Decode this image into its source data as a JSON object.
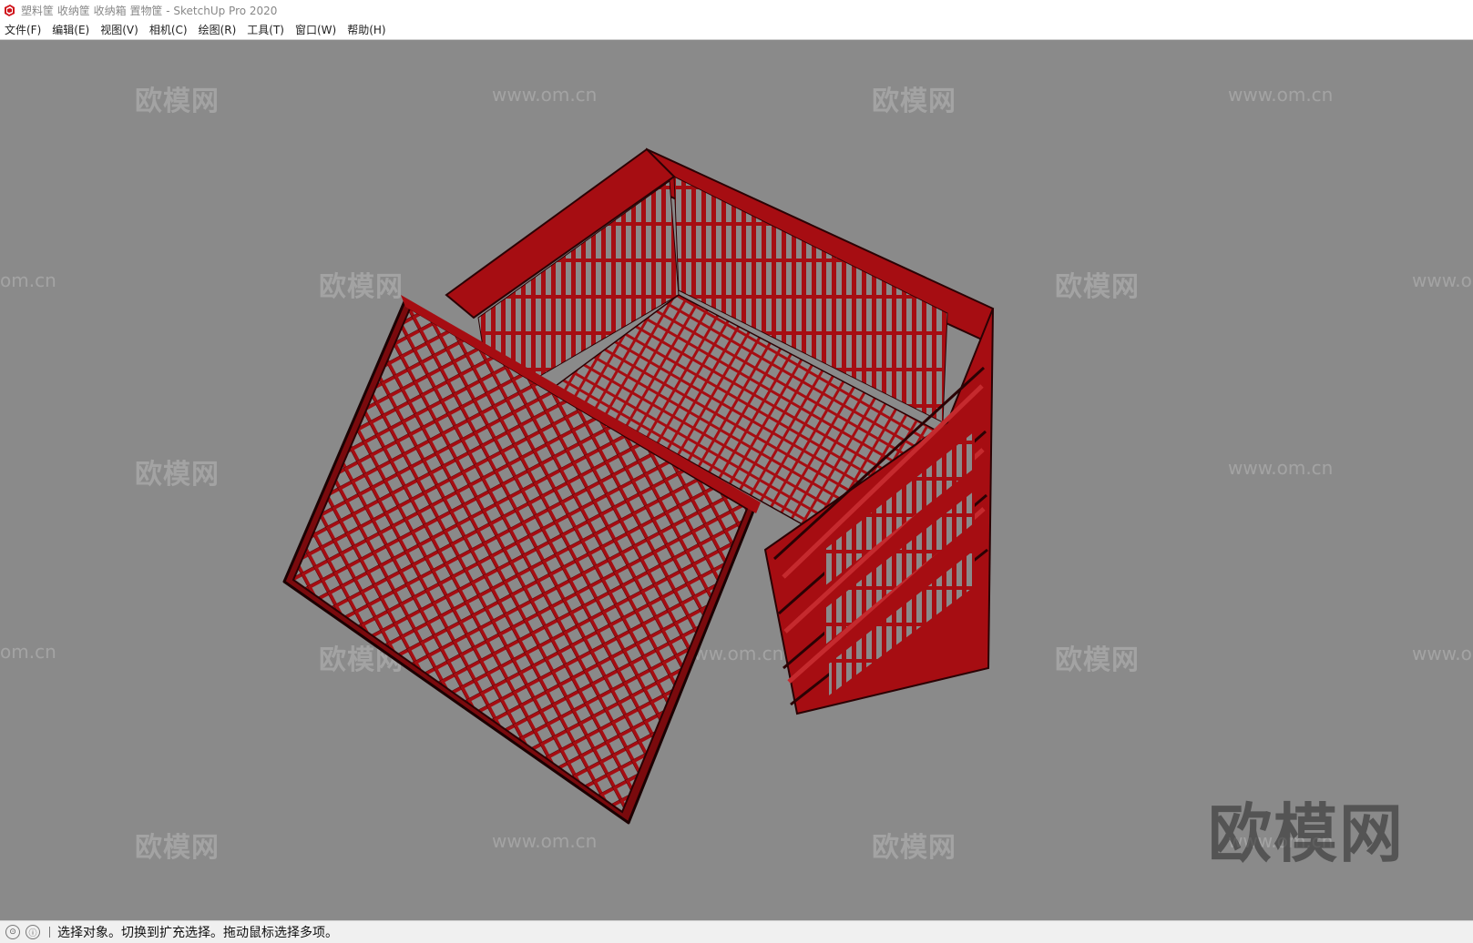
{
  "window": {
    "title": "塑料筐 收纳筐 收纳箱 置物筐 - SketchUp Pro 2020"
  },
  "menu": [
    "文件(F)",
    "编辑(E)",
    "视图(V)",
    "相机(C)",
    "绘图(R)",
    "工具(T)",
    "窗口(W)",
    "帮助(H)"
  ],
  "watermarks": {
    "brand_cn": "欧模网",
    "brand_url": "www.om.cn",
    "edge_url": "om.cn",
    "edge_url_right": "www.o"
  },
  "status": {
    "message": "选择对象。切换到扩充选择。拖动鼠标选择多项。"
  },
  "colors": {
    "model_red": "#a60d12",
    "background": "#8a8a8a"
  }
}
